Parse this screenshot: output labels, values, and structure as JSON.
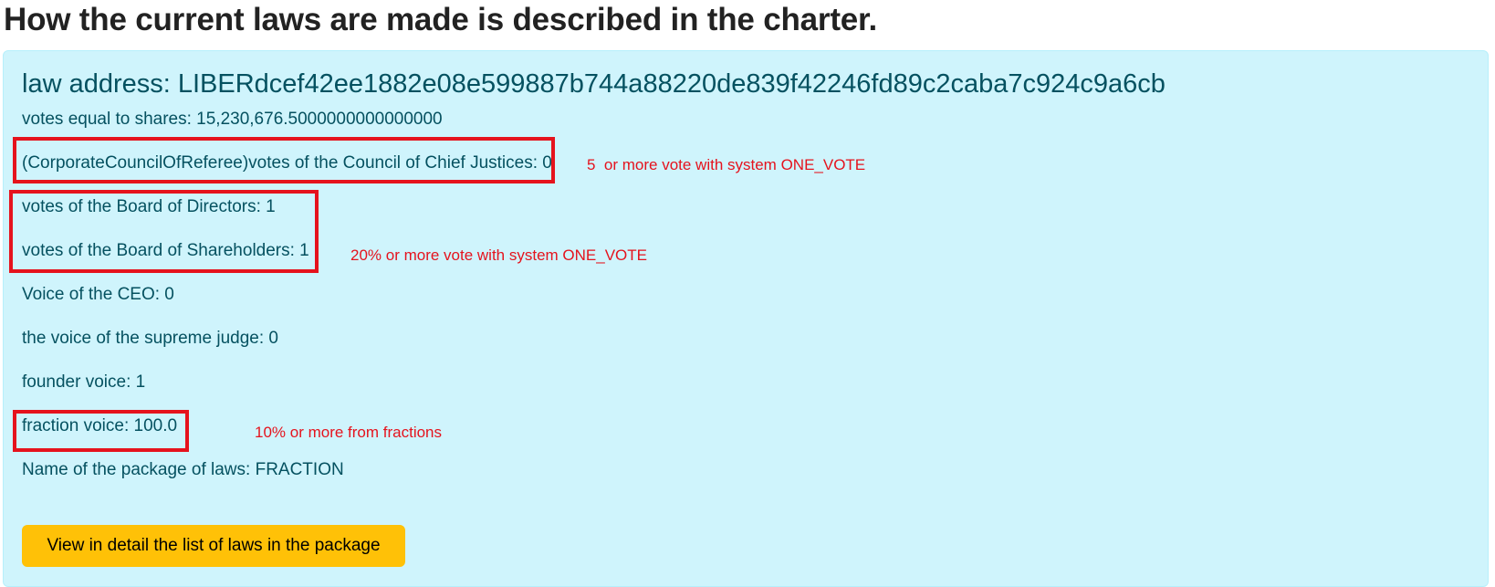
{
  "page": {
    "title": "How the current laws are made is described in the charter."
  },
  "card": {
    "law_address": "law address: LIBERdcef42ee1882e08e599887b744a88220de839f42246fd89c2caba7c924c9a6cb",
    "rows": {
      "votes_equal_shares": "votes equal to shares: 15,230,676.5000000000000000",
      "council_chief_justices": "(CorporateCouncilOfReferee)votes of the Council of Chief Justices: 0",
      "board_directors": "votes of the Board of Directors: 1",
      "board_shareholders": "votes of the Board of Shareholders: 1",
      "ceo_voice": "Voice of the CEO: 0",
      "supreme_judge_voice": "the voice of the supreme judge: 0",
      "founder_voice": "founder voice: 1",
      "fraction_voice": "fraction voice: 100.0",
      "package_name": "Name of the package of laws: FRACTION"
    },
    "button_label": "View in detail the list of laws in the package"
  },
  "annotations": {
    "council_note": "5  or more vote with system ONE_VOTE",
    "boards_note": "20% or more vote with system ONE_VOTE",
    "fraction_note": "10% or more from fractions",
    "color": "#e5131d"
  },
  "colors": {
    "card_background": "#cff4fc",
    "card_text": "#055160",
    "button_background": "#ffc107"
  }
}
